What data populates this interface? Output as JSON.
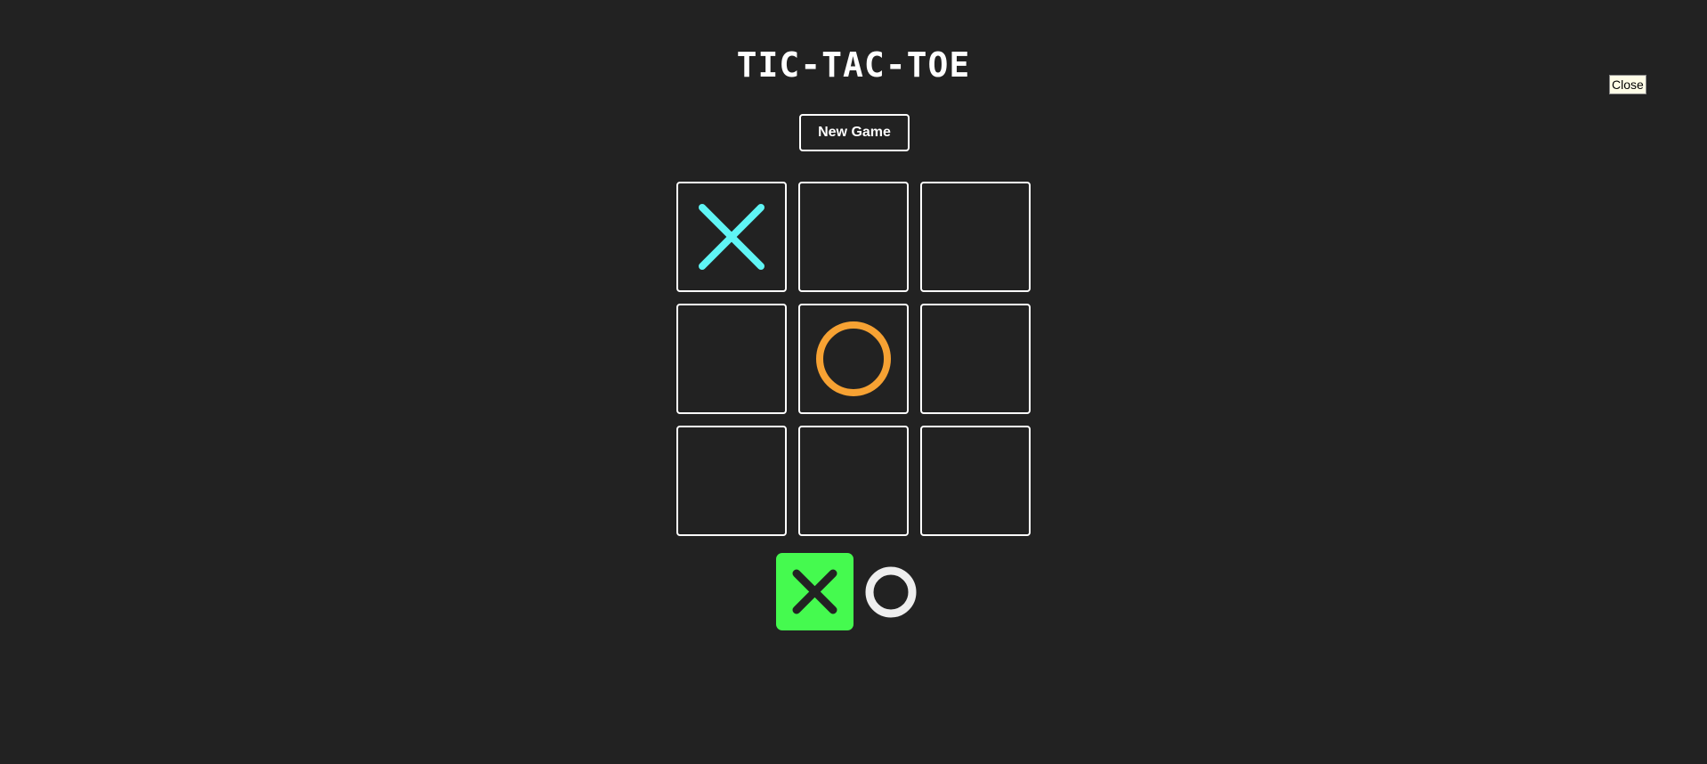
{
  "title": "TIC-TAC-TOE",
  "new_game_label": "New Game",
  "close_label": "Close",
  "board": [
    "X",
    "",
    "",
    "",
    "O",
    "",
    "",
    "",
    ""
  ],
  "current_turn": "X",
  "colors": {
    "background": "#222222",
    "x_mark": "#5ff5f5",
    "o_mark": "#f7a233",
    "active_turn_bg": "#45fa4f",
    "turn_mark_dark": "#222222",
    "turn_mark_light": "#eeeeee"
  },
  "icons": {
    "x": "x-mark-icon",
    "o": "o-mark-icon"
  }
}
